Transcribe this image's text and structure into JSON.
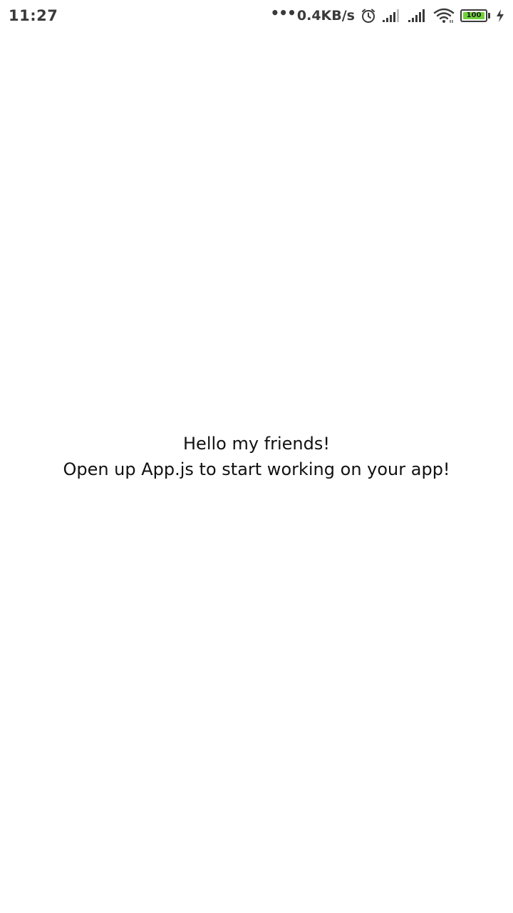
{
  "status_bar": {
    "time": "11:27",
    "dots": "•••",
    "net_speed": "0.4KB/s",
    "battery_level": "100",
    "icons": [
      "alarm-icon",
      "signal-icon",
      "signal-icon",
      "wifi-icon",
      "battery-icon",
      "charging-icon"
    ],
    "battery_color": "#6fd23a"
  },
  "main": {
    "line1": "Hello my friends!",
    "line2": "Open up App.js to start working on your app!"
  }
}
